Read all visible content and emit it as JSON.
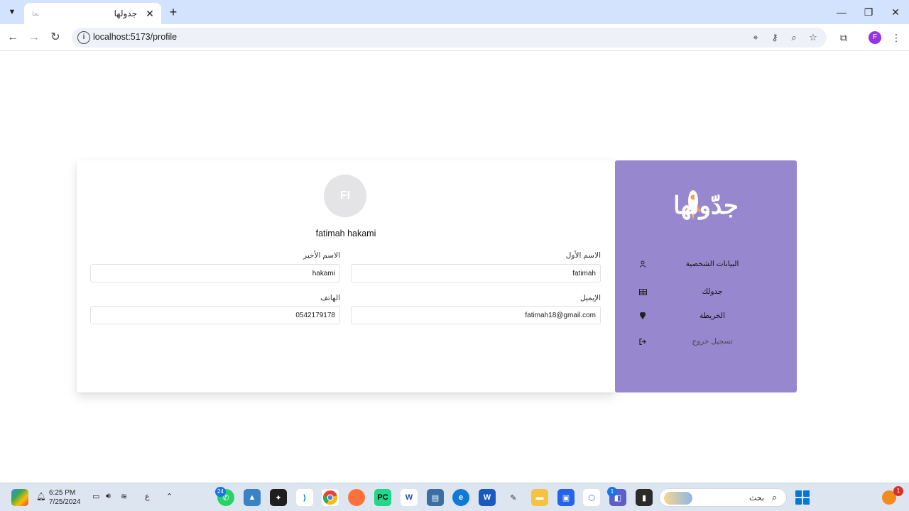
{
  "browser": {
    "tab_title": "جدولها",
    "favicon_text": "نجا",
    "url": "localhost:5173/profile",
    "profile_initial": "F"
  },
  "profile": {
    "avatar_initials": "FI",
    "full_name": "fatimah hakami",
    "fields": {
      "first_name_label": "الاسم الأول",
      "first_name_value": "fatimah",
      "last_name_label": "الاسم الأخير",
      "last_name_value": "hakami",
      "email_label": "الإيميل",
      "email_value": "fatimah18@gmail.com",
      "phone_label": "الهاتف",
      "phone_value": "0542179178"
    }
  },
  "sidebar": {
    "logo_text": "جدّولها",
    "items": [
      {
        "label": "البيانات الشخصية",
        "icon": "user-icon"
      },
      {
        "label": "جدولك",
        "icon": "table-icon"
      },
      {
        "label": "الخريطة",
        "icon": "map-pin-icon"
      },
      {
        "label": "تسجيل خروج",
        "icon": "logout-icon"
      }
    ],
    "background_color": "#9787cf"
  },
  "taskbar": {
    "time": "6:25 PM",
    "date": "7/25/2024",
    "language": "ع",
    "search_placeholder": "بحث",
    "whatsapp_badge": "24",
    "teams_badge": "1",
    "notification_badge": "1"
  }
}
